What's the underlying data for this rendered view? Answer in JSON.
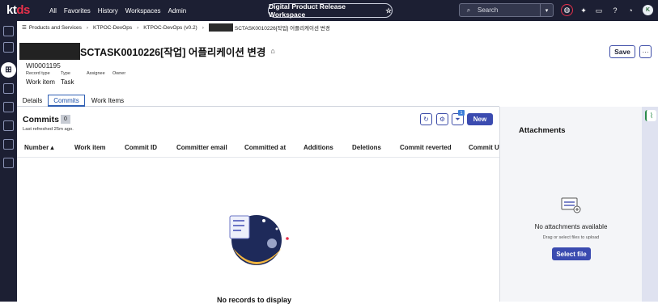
{
  "brand": {
    "logo_k": "kt",
    "logo_ds": "ds"
  },
  "nav": {
    "items": [
      "All",
      "Favorites",
      "History",
      "Workspaces",
      "Admin"
    ]
  },
  "workspace": {
    "label": "Digital Product Release Workspace"
  },
  "search": {
    "placeholder": "Search"
  },
  "user": {
    "initial": "K"
  },
  "breadcrumb": {
    "items": [
      "Products and Services",
      "KTPOC-DevOps",
      "KTPOC-DevOps (v0.2)",
      "SCTASK0010226[작업] 어플리케이션 변경"
    ]
  },
  "record": {
    "title": "SCTASK0010226[작업] 어플리케이션 변경",
    "id": "WI0001195",
    "fields": [
      {
        "label": "Record type",
        "value": "Work item"
      },
      {
        "label": "Type",
        "value": "Task"
      },
      {
        "label": "Assignee",
        "value": ""
      },
      {
        "label": "Owner",
        "value": ""
      }
    ]
  },
  "actions": {
    "save": "Save",
    "more": "···"
  },
  "tabs": [
    {
      "label": "Details",
      "active": false
    },
    {
      "label": "Commits",
      "active": true
    },
    {
      "label": "Work Items",
      "active": false
    }
  ],
  "commits": {
    "heading": "Commits",
    "count": "0",
    "refreshed": "Last refreshed 25m ago.",
    "filter_badge": "1",
    "new_label": "New",
    "columns": [
      "Number ▴",
      "Work item",
      "Commit ID",
      "Committer email",
      "Committed at",
      "Additions",
      "Deletions",
      "Commit reverted",
      "Commit UR"
    ],
    "empty_text": "No records to display"
  },
  "attachments": {
    "heading": "Attachments",
    "empty": "No attachments available",
    "hint": "Drag or select files to upload",
    "select_label": "Select file"
  },
  "colors": {
    "topbar": "#1c1f33",
    "primary": "#3b4bb0",
    "brand_red": "#e8304a"
  }
}
